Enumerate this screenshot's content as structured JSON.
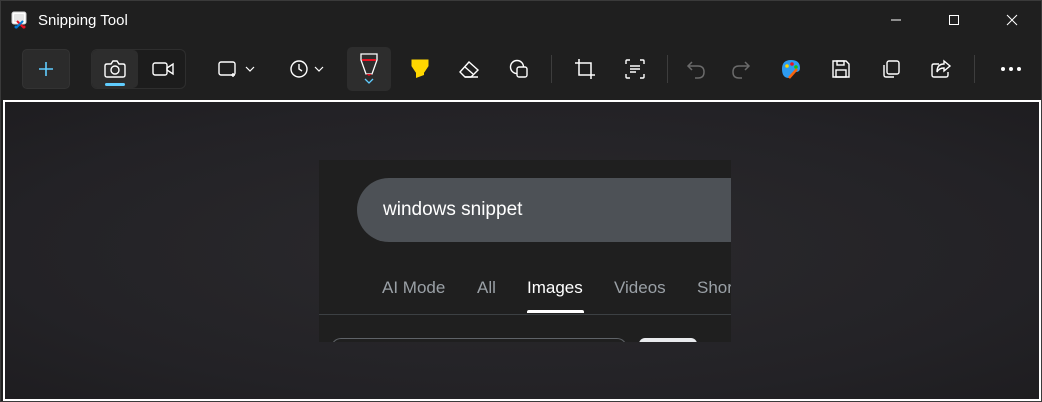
{
  "window": {
    "title": "Snipping Tool",
    "controls": [
      "minimize",
      "maximize",
      "close"
    ]
  },
  "toolbar": {
    "items": [
      {
        "name": "new-snip",
        "icon": "plus-icon"
      },
      {
        "name": "snip-mode-screenshot",
        "icon": "camera-icon",
        "selected": true
      },
      {
        "name": "snip-mode-record",
        "icon": "video-camera-icon"
      },
      {
        "name": "snip-shape",
        "icon": "rectangle-snip-icon"
      },
      {
        "name": "snip-delay",
        "icon": "clock-icon"
      },
      {
        "name": "ballpoint-pen",
        "icon": "pen-icon",
        "color": "#e81123",
        "selected": true
      },
      {
        "name": "highlighter",
        "icon": "highlighter-icon",
        "color": "#ffd700"
      },
      {
        "name": "eraser",
        "icon": "eraser-icon"
      },
      {
        "name": "shapes",
        "icon": "shapes-icon"
      },
      {
        "name": "crop",
        "icon": "crop-icon"
      },
      {
        "name": "text-actions",
        "icon": "text-actions-icon"
      },
      {
        "name": "undo",
        "icon": "undo-icon",
        "disabled": true
      },
      {
        "name": "redo",
        "icon": "redo-icon",
        "disabled": true
      },
      {
        "name": "edit-in-paint",
        "icon": "paint-icon"
      },
      {
        "name": "save",
        "icon": "save-icon"
      },
      {
        "name": "copy",
        "icon": "copy-icon"
      },
      {
        "name": "share",
        "icon": "share-icon"
      },
      {
        "name": "more",
        "icon": "more-icon"
      }
    ],
    "accent": "#60cdff"
  },
  "capture": {
    "search_text": "windows snippet",
    "tabs": [
      {
        "label": "AI Mode",
        "active": false
      },
      {
        "label": "All",
        "active": false
      },
      {
        "label": "Images",
        "active": true
      },
      {
        "label": "Videos",
        "active": false
      },
      {
        "label": "Shor",
        "active": false
      }
    ]
  }
}
